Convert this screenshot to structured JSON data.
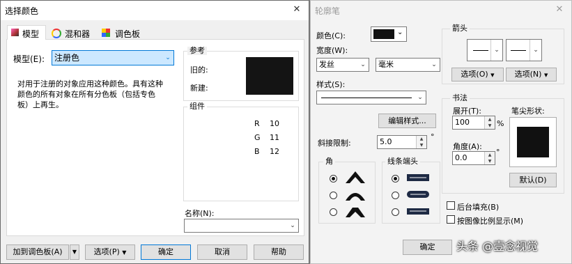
{
  "color_dialog": {
    "title": "选择颜色",
    "tabs": [
      "模型",
      "混和器",
      "调色板"
    ],
    "model_label": "模型(E):",
    "model_value": "注册色",
    "description": "对用于注册的对象应用这种颜色。具有这种颜色的所有对象在所有分色板（包括专色板）上再生。",
    "reference_label": "参考",
    "old_label": "旧的:",
    "new_label": "新建:",
    "swatch_color": "#141414",
    "components_label": "组件",
    "components": [
      {
        "name": "R",
        "value": "10"
      },
      {
        "name": "G",
        "value": "11"
      },
      {
        "name": "B",
        "value": "12"
      }
    ],
    "name_label": "名称(N):",
    "name_value": "",
    "buttons": {
      "add_palette": "加到调色板(A)",
      "options": "选项(P)",
      "ok": "确定",
      "cancel": "取消",
      "help": "帮助"
    }
  },
  "pen_dialog": {
    "title": "轮廓笔",
    "color_label": "颜色(C):",
    "width_label": "宽度(W):",
    "width_value": "发丝",
    "unit_value": "毫米",
    "style_label": "样式(S):",
    "edit_style_button": "编辑样式...",
    "miter_label": "斜接限制:",
    "miter_value": "5.0",
    "degree_symbol": "°",
    "corner_label": "角",
    "linecap_label": "线条端头",
    "arrows_label": "箭头",
    "arrow_options": [
      "选项(O)",
      "选项(N)"
    ],
    "calligraphy_label": "书法",
    "stretch_label": "展开(T):",
    "stretch_value": "100",
    "percent_symbol": "%",
    "angle_label": "角度(A):",
    "angle_value": "0.0",
    "nib_label": "笔尖形状:",
    "default_button": "默认(D)",
    "behind_fill_label": "后台填充(B)",
    "scale_label": "按图像比例显示(M)",
    "ok_button": "确定"
  },
  "watermark": "头条 @壹念视觉",
  "colors": {
    "pen_color": "#111111",
    "selection": "#cce8ff",
    "accent_border": "#0078d7"
  }
}
